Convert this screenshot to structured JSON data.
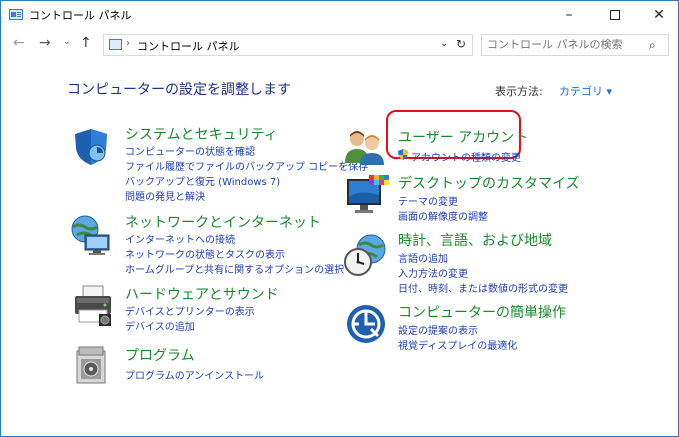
{
  "window": {
    "title": "コントロール パネル",
    "controls": {
      "minimize": "–",
      "maximize": "",
      "close": "✕"
    }
  },
  "nav": {
    "back": "←",
    "forward": "→",
    "recent": "⌄",
    "up": "↑",
    "address": "コントロール パネル",
    "address_sep": "›",
    "address_dropdown": "⌄",
    "refresh": "↻",
    "search_placeholder": "コントロール パネルの検索"
  },
  "main": {
    "heading": "コンピューターの設定を調整します",
    "view_by_label": "表示方法:",
    "view_by_value": "カテゴリ ▾"
  },
  "categories_left": [
    {
      "title": "システムとセキュリティ",
      "icon": "shield-icon",
      "links": [
        "コンピューターの状態を確認",
        "ファイル履歴でファイルのバックアップ コピーを保存",
        "バックアップと復元 (Windows 7)",
        "問題の発見と解決"
      ]
    },
    {
      "title": "ネットワークとインターネット",
      "icon": "network-globe-icon",
      "links": [
        "インターネットへの接続",
        "ネットワークの状態とタスクの表示",
        "ホームグループと共有に関するオプションの選択"
      ]
    },
    {
      "title": "ハードウェアとサウンド",
      "icon": "printer-icon",
      "links": [
        "デバイスとプリンターの表示",
        "デバイスの追加"
      ]
    },
    {
      "title": "プログラム",
      "icon": "programs-box-icon",
      "links": [
        "プログラムのアンインストール"
      ]
    }
  ],
  "categories_right": [
    {
      "title": "ユーザー アカウント",
      "icon": "users-icon",
      "links": [
        "アカウントの種類の変更"
      ]
    },
    {
      "title": "デスクトップのカスタマイズ",
      "icon": "desktop-monitor-icon",
      "links": [
        "テーマの変更",
        "画面の解像度の調整"
      ]
    },
    {
      "title": "時計、言語、および地域",
      "icon": "clock-globe-icon",
      "links": [
        "言語の追加",
        "入力方法の変更",
        "日付、時刻、または数値の形式の変更"
      ]
    },
    {
      "title": "コンピューターの簡単操作",
      "icon": "ease-of-access-icon",
      "links": [
        "設定の提案の表示",
        "視覚ディスプレイの最適化"
      ]
    }
  ],
  "colors": {
    "heading": "#1e3287",
    "category_title": "#1a8a2c",
    "link": "#1e3fb0",
    "highlight_border": "#e0101e"
  }
}
